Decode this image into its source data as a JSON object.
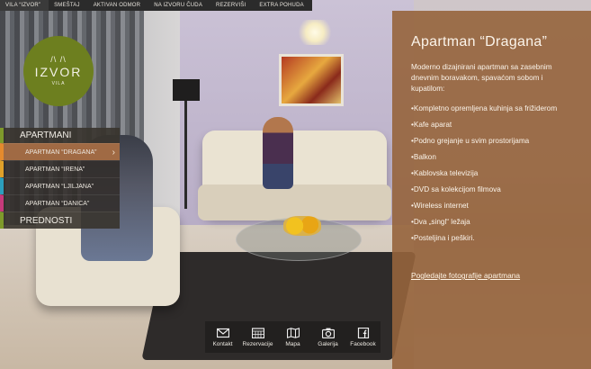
{
  "nav": {
    "items": [
      {
        "label": "VILA “IZVOR”",
        "active": true
      },
      {
        "label": "SMEŠTAJ",
        "active": false
      },
      {
        "label": "AKTIVAN ODMOR",
        "active": false
      },
      {
        "label": "NA IZVORU ČUDA",
        "active": false
      },
      {
        "label": "REZERVIŠI",
        "active": false
      },
      {
        "label": "EXTRA POHUDA",
        "active": false
      }
    ]
  },
  "logo": {
    "mark": "/\\ /\\",
    "name": "IZVOR",
    "sub": "VILA",
    "color": "#6d7f1f"
  },
  "sidemenu": {
    "header": "APARTMANI",
    "items": [
      {
        "label": "APARTMAN “DRAGANA”",
        "active": true
      },
      {
        "label": "APARTMAN “IRENA”",
        "active": false
      },
      {
        "label": "APARTMAN “LJILJANA”",
        "active": false
      },
      {
        "label": "APARTMAN “DANICA”",
        "active": false
      }
    ],
    "footer": "PREDNOSTI"
  },
  "toolbar": {
    "items": [
      {
        "label": "Kontakt",
        "icon": "envelope-icon"
      },
      {
        "label": "Rezervacije",
        "icon": "calendar-icon"
      },
      {
        "label": "Mapa",
        "icon": "map-icon"
      },
      {
        "label": "Galerija",
        "icon": "camera-icon"
      },
      {
        "label": "Facebook",
        "icon": "facebook-icon"
      }
    ]
  },
  "panel": {
    "title": "Apartman “Dragana”",
    "description": "Moderno dizajnirani  apartman sa zasebnim dnevnim boravakom, spavaćom sobom i kupatilom:",
    "features": [
      "•Kompletno opremljena kuhinja sa frižiderom",
      "•Kafe aparat",
      "•Podno grejanje u svim prostorijama",
      "•Balkon",
      "•Kablovska televizija",
      "•DVD sa kolekcijom filmova",
      "•Wireless internet",
      "•Dva „singl“ ležaja",
      "•Posteljina i peškiri."
    ],
    "link": "Pogledajte fotografije apartmana",
    "bg_color": "#96643c"
  }
}
